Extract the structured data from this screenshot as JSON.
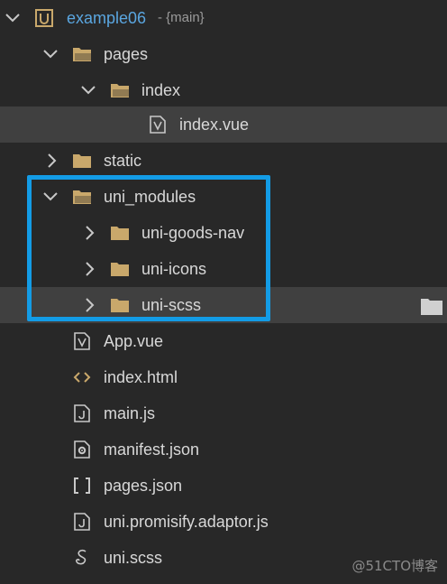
{
  "project": {
    "name": "example06",
    "branch": "- {main}"
  },
  "tree": {
    "pages_folder": "pages",
    "index_folder": "index",
    "index_vue": "index.vue",
    "static_folder": "static",
    "uni_modules_folder": "uni_modules",
    "goods_nav_folder": "uni-goods-nav",
    "icons_folder": "uni-icons",
    "scss_folder": "uni-scss",
    "app_vue": "App.vue",
    "index_html": "index.html",
    "main_js": "main.js",
    "manifest_json": "manifest.json",
    "pages_json": "pages.json",
    "promisify_js": "uni.promisify.adaptor.js",
    "uni_scss": "uni.scss"
  },
  "watermark": "@51CTO博客",
  "colors": {
    "background": "#282828",
    "selected_row": "#404040",
    "highlight_box": "#139ce6",
    "folder": "#c9a86b",
    "project_label": "#5aa6e0"
  }
}
